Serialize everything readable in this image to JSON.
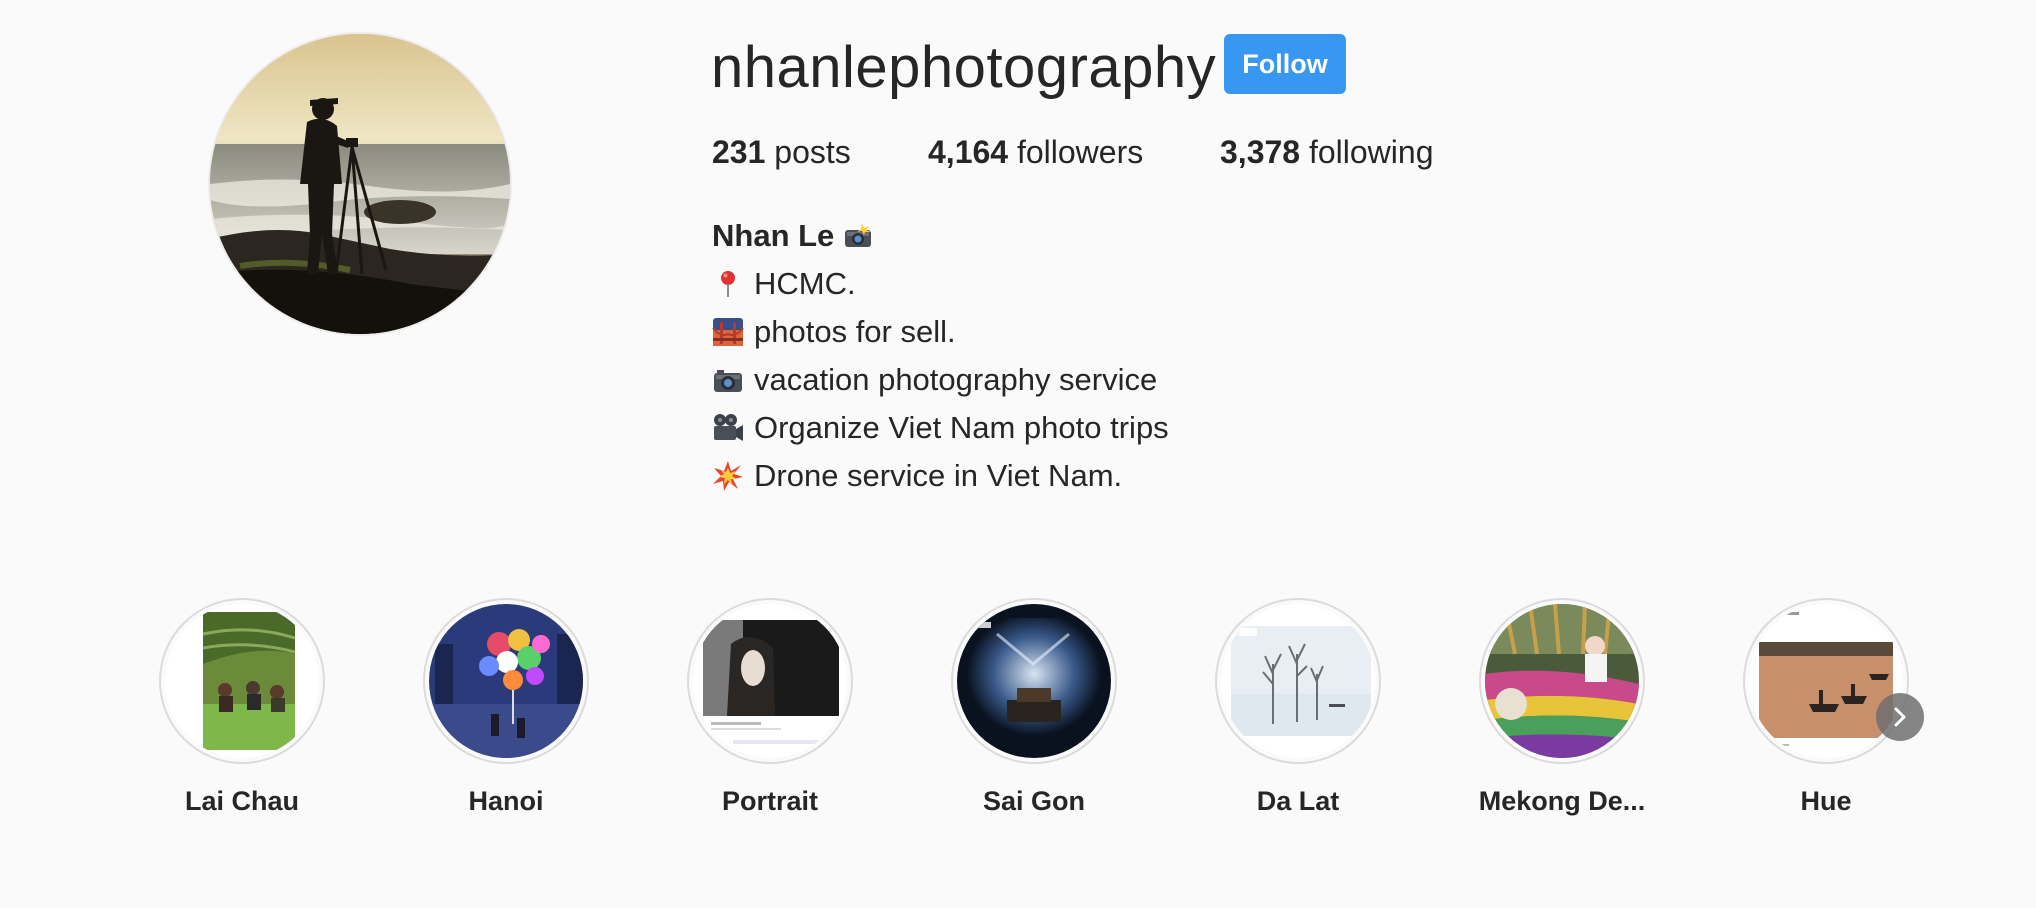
{
  "profile": {
    "username": "nhanlephotography",
    "follow_label": "Follow",
    "avatar_icon": "profile-photo-photographer-silhouette"
  },
  "stats": {
    "posts_count": "231",
    "posts_label": "posts",
    "followers_count": "4,164",
    "followers_label": "followers",
    "following_count": "3,378",
    "following_label": "following"
  },
  "bio": {
    "name": "Nhan Le",
    "name_emoji": "camera-flash-icon",
    "lines": [
      {
        "icon": "round-pushpin-icon",
        "text": "HCMC."
      },
      {
        "icon": "sunset-bridge-icon",
        "text": "photos for sell."
      },
      {
        "icon": "camera-icon",
        "text": "vacation photography service"
      },
      {
        "icon": "movie-camera-icon",
        "text": "Organize Viet Nam photo trips"
      },
      {
        "icon": "collision-icon",
        "text": "Drone service in Viet Nam."
      }
    ]
  },
  "highlights": [
    {
      "label": "Lai Chau"
    },
    {
      "label": "Hanoi"
    },
    {
      "label": "Portrait"
    },
    {
      "label": "Sai Gon"
    },
    {
      "label": "Da Lat"
    },
    {
      "label": "Mekong De..."
    },
    {
      "label": "Hue"
    }
  ],
  "colors": {
    "follow_button": "#3897f0",
    "text": "#262626",
    "background": "#fafafa"
  }
}
